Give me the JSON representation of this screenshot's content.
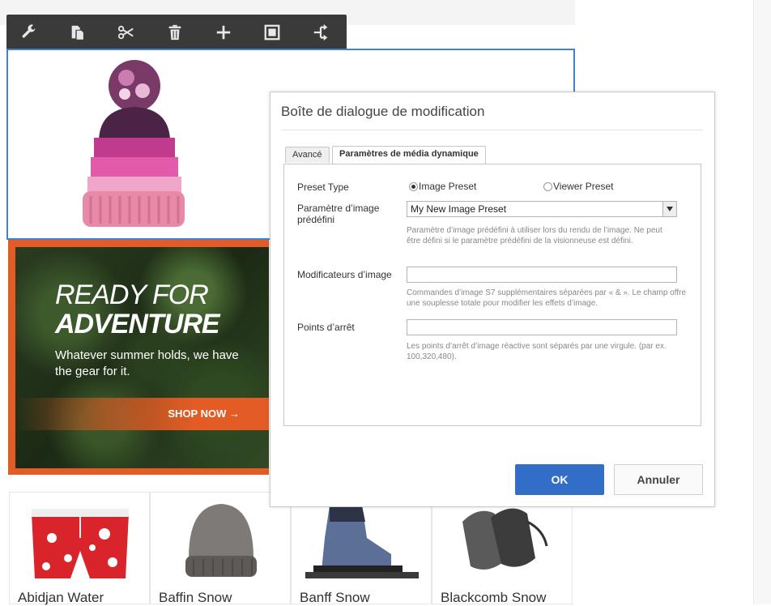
{
  "toolbar": {
    "icons": [
      "wrench-icon",
      "copy-icon",
      "cut-icon",
      "trash-icon",
      "plus-icon",
      "frame-icon",
      "parent-icon"
    ]
  },
  "banner": {
    "line1": "READY FOR",
    "line2": "ADVENTURE",
    "subtitle": "Whatever summer holds, we have the gear for it.",
    "cta": "SHOP NOW →"
  },
  "products": [
    {
      "name": "Abidjan Water"
    },
    {
      "name": "Baffin Snow"
    },
    {
      "name": "Banff Snow"
    },
    {
      "name": "Blackcomb Snow"
    }
  ],
  "dialog": {
    "title": "Boîte de dialogue de modification",
    "tabs": [
      "Avancé",
      "Paramètres de média dynamique"
    ],
    "preset_type_label": "Preset Type",
    "radio_image": "Image Preset",
    "radio_viewer": "Viewer Preset",
    "image_preset_label": "Paramètre d’image prédéfini",
    "image_preset_value": "My New Image Preset",
    "image_preset_hint": "Paramètre d’image prédéfini à utiliser lors du rendu de l’image. Ne peut être défini si le paramètre prédéfini de la visionneuse est défini.",
    "modifiers_label": "Modificateurs d’image",
    "modifiers_value": "",
    "modifiers_hint": "Commandes d’image S7 supplémentaires séparées par « & ». Le champ offre une souplesse totale pour modifier les effets d’image.",
    "breakpoints_label": "Points d’arrêt",
    "breakpoints_value": "",
    "breakpoints_hint": "Les points d’arrêt d’image réactive sont séparés par une virgule. (par ex. 100,320,480).",
    "ok": "OK",
    "cancel": "Annuler"
  },
  "colors": {
    "accent": "#326ec8",
    "selection": "#3f82d3",
    "banner_orange": "#e35b25",
    "toolbar": "#3a3a3a"
  }
}
